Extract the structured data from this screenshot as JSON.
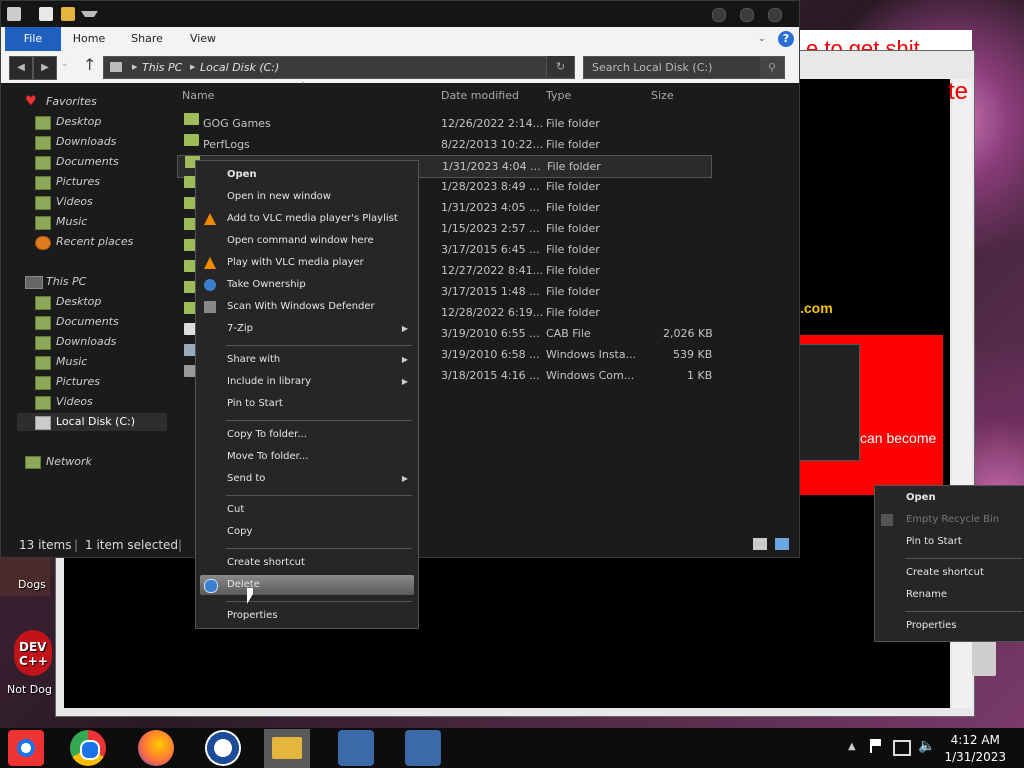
{
  "explorer": {
    "ribbon_tabs": [
      "File",
      "Home",
      "Share",
      "View"
    ],
    "address": {
      "this_pc": "This PC",
      "drive": "Local Disk (C:)"
    },
    "search_placeholder": "Search Local Disk (C:)",
    "nav": {
      "favorites": "Favorites",
      "fav_items": [
        "Desktop",
        "Downloads",
        "Documents",
        "Pictures",
        "Videos",
        "Music",
        "Recent places"
      ],
      "this_pc": "This PC",
      "pc_items": [
        "Desktop",
        "Documents",
        "Downloads",
        "Music",
        "Pictures",
        "Videos",
        "Local Disk (C:)"
      ],
      "network": "Network"
    },
    "columns": {
      "name": "Name",
      "date": "Date modified",
      "type": "Type",
      "size": "Size"
    },
    "rows": [
      {
        "name": "GOG Games",
        "date": "12/26/2022 2:14...",
        "type": "File folder",
        "size": ""
      },
      {
        "name": "PerfLogs",
        "date": "8/22/2013 10:22...",
        "type": "File folder",
        "size": ""
      },
      {
        "name": "",
        "date": "1/31/2023 4:04 ...",
        "type": "File folder",
        "size": ""
      },
      {
        "name": "",
        "date": "1/28/2023 8:49 ...",
        "type": "File folder",
        "size": ""
      },
      {
        "name": "",
        "date": "1/31/2023 4:05 ...",
        "type": "File folder",
        "size": ""
      },
      {
        "name": "",
        "date": "1/15/2023 2:57 ...",
        "type": "File folder",
        "size": ""
      },
      {
        "name": "",
        "date": "3/17/2015 6:45 ...",
        "type": "File folder",
        "size": ""
      },
      {
        "name": "",
        "date": "12/27/2022 8:41...",
        "type": "File folder",
        "size": ""
      },
      {
        "name": "",
        "date": "3/17/2015 1:48 ...",
        "type": "File folder",
        "size": ""
      },
      {
        "name": "",
        "date": "12/28/2022 6:19...",
        "type": "File folder",
        "size": ""
      },
      {
        "name": "",
        "date": "3/19/2010 6:55 ...",
        "type": "CAB File",
        "size": "2,026 KB"
      },
      {
        "name": "",
        "date": "3/19/2010 6:58 ...",
        "type": "Windows Insta...",
        "size": "539 KB"
      },
      {
        "name": "",
        "date": "3/18/2015 4:16 ...",
        "type": "Windows Com...",
        "size": "1 KB"
      }
    ],
    "status": {
      "items": "13 items",
      "selected": "1 item selected"
    }
  },
  "context_menu": [
    {
      "label": "Open",
      "bold": true
    },
    {
      "label": "Open in new window"
    },
    {
      "label": "Add to VLC media player's Playlist",
      "icon": "vlc-icon"
    },
    {
      "label": "Open command window here"
    },
    {
      "label": "Play with VLC media player",
      "icon": "vlc-icon"
    },
    {
      "label": "Take Ownership",
      "icon": "gear-icon"
    },
    {
      "label": "Scan With Windows Defender",
      "icon": "defender-icon"
    },
    {
      "label": "7-Zip",
      "submenu": true
    },
    {
      "label": "Share with",
      "submenu": true
    },
    {
      "label": "Include in library",
      "submenu": true
    },
    {
      "label": "Pin to Start"
    },
    {
      "label": "Copy To folder..."
    },
    {
      "label": "Move To folder..."
    },
    {
      "label": "Send to",
      "submenu": true
    },
    {
      "label": "Cut"
    },
    {
      "label": "Copy"
    },
    {
      "label": "Create shortcut"
    },
    {
      "label": "Delete",
      "icon": "gear-icon",
      "highlighted": true
    },
    {
      "label": "Properties"
    }
  ],
  "desktop_menu": [
    {
      "label": "Open",
      "bold": true
    },
    {
      "label": "Empty Recycle Bin",
      "disabled": true
    },
    {
      "label": "Pin to Start"
    },
    {
      "label": "Create shortcut"
    },
    {
      "label": "Rename"
    },
    {
      "label": "Properties"
    }
  ],
  "background": {
    "com_text": ".com",
    "red_text": "can become",
    "banner_text": "e to get shit",
    "banner_te": "te"
  },
  "desktop_icons": {
    "dogs": "Dogs",
    "not_dog": "Not Dog",
    "dev": "DEV C++"
  },
  "taskbar": {
    "time": "4:12 AM",
    "date": "1/31/2023",
    "apps": [
      "chrome-icon",
      "chrome-icon",
      "firefox-icon",
      "obama-icon",
      "file-explorer-icon",
      "network-setup-icon",
      "network-setup-icon"
    ]
  }
}
